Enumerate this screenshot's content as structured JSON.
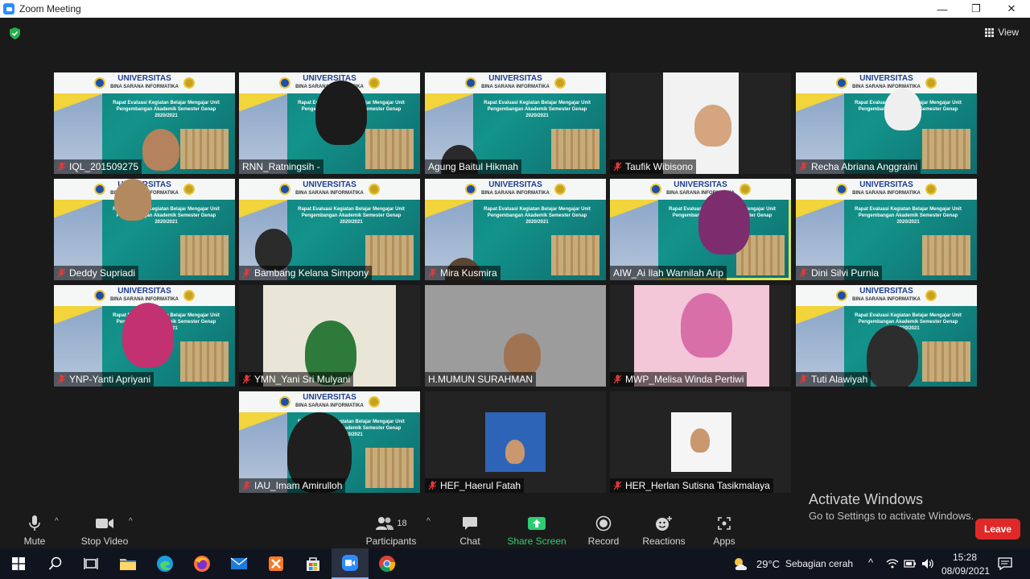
{
  "window": {
    "title": "Zoom Meeting",
    "controls": [
      "—",
      "❐",
      "✕"
    ]
  },
  "header": {
    "view_label": "View"
  },
  "slide": {
    "university": "UNIVERSITAS",
    "subtitle": "BINA SARANA INFORMATIKA",
    "event_line1": "Rapat Evaluasi Kegiatan Belajar Mengajar Unit",
    "event_line2": "Pengembangan Akademik Semester Genap 2020/2021"
  },
  "participants": [
    {
      "name": "IQL_201509275",
      "muted": true
    },
    {
      "name": "RNN_Ratningsih -",
      "muted": false
    },
    {
      "name": "Agung Baitul Hikmah",
      "muted": false
    },
    {
      "name": "Taufik Wibisono",
      "muted": true
    },
    {
      "name": "Recha Abriana Anggraini",
      "muted": true
    },
    {
      "name": "Deddy Supriadi",
      "muted": true
    },
    {
      "name": "Bambang Kelana Simpony",
      "muted": true
    },
    {
      "name": "Mira Kusmira",
      "muted": true
    },
    {
      "name": "AIW_Ai Ilah Warnilah Arip",
      "muted": false
    },
    {
      "name": "Dini Silvi Purnia",
      "muted": true
    },
    {
      "name": "YNP-Yanti Apriyani",
      "muted": true
    },
    {
      "name": "YMN_Yani Sri Mulyani",
      "muted": true
    },
    {
      "name": "H.MUMUN SURAHMAN",
      "muted": false
    },
    {
      "name": "MWP_Melisa Winda Pertiwi",
      "muted": true
    },
    {
      "name": "Tuti Alawiyah",
      "muted": true
    },
    {
      "name": "IAU_Imam Amirulloh",
      "muted": true
    },
    {
      "name": "HEF_Haerul Fatah",
      "muted": true
    },
    {
      "name": "HER_Herlan Sutisna Tasikmalaya",
      "muted": true
    }
  ],
  "toolbar": {
    "mute": "Mute",
    "stop_video": "Stop Video",
    "participants": "Participants",
    "participants_count": "18",
    "chat": "Chat",
    "share_screen": "Share Screen",
    "record": "Record",
    "reactions": "Reactions",
    "apps": "Apps",
    "leave": "Leave"
  },
  "watermark": {
    "line1": "Activate Windows",
    "line2": "Go to Settings to activate Windows."
  },
  "taskbar": {
    "weather_temp": "29°C",
    "weather_desc": "Sebagian cerah",
    "time": "15:28",
    "date": "08/09/2021"
  },
  "colors": {
    "leave": "#e02828",
    "share_green": "#2ecc71",
    "active_speaker": "#d7e35b",
    "zoom_blue": "#2d8cff"
  }
}
